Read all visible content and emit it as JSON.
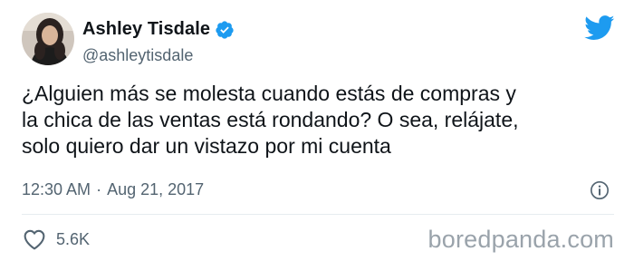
{
  "author": {
    "name": "Ashley Tisdale",
    "handle": "@ashleytisdale",
    "verified": true
  },
  "tweet": {
    "text": "¿Alguien más se molesta cuando estás de compras y\nla chica de las ventas está rondando? O sea, relájate,\nsolo quiero dar un vistazo por mi cuenta",
    "time": "12:30 AM",
    "separator": "·",
    "date": "Aug 21, 2017"
  },
  "engagement": {
    "likes": "5.6K"
  },
  "watermark": "boredpanda.com",
  "colors": {
    "brand": "#1d9bf0",
    "text": "#0f1419",
    "secondary": "#536471"
  },
  "icons": [
    "verified-badge-icon",
    "twitter-bird-icon",
    "info-icon",
    "heart-icon"
  ]
}
